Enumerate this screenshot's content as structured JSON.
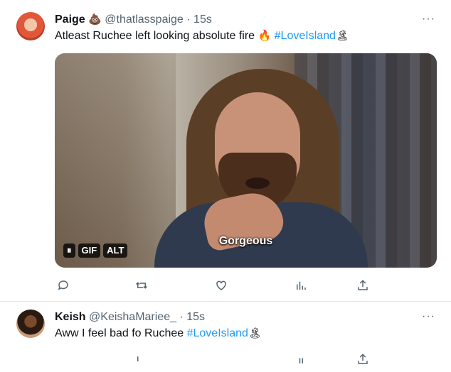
{
  "tweets": [
    {
      "name": "Paige",
      "name_emoji": "💩",
      "handle": "@thatlasspaige",
      "separator": "·",
      "time": "15s",
      "text": "Atleast Ruchee left looking absolute fire",
      "text_emoji": "🔥",
      "hashtag": "#LoveIsland",
      "hashtag_emoji": "🏝",
      "media": {
        "subtitle": "Gorgeous",
        "badges": [
          "⏸",
          "GIF",
          "ALT"
        ]
      },
      "more": "···"
    },
    {
      "name": "Keish",
      "handle": "@KeishaMariee_",
      "separator": "·",
      "time": "15s",
      "text": "Aww I feel bad fo  Ruchee",
      "hashtag": "#LoveIsland",
      "hashtag_emoji": "🏝",
      "more": "···"
    }
  ],
  "colors": {
    "accent": "#1d9bf0",
    "muted": "#536471",
    "text": "#0f1419"
  },
  "icons": [
    "reply-icon",
    "retweet-icon",
    "like-icon",
    "views-icon",
    "share-icon"
  ]
}
